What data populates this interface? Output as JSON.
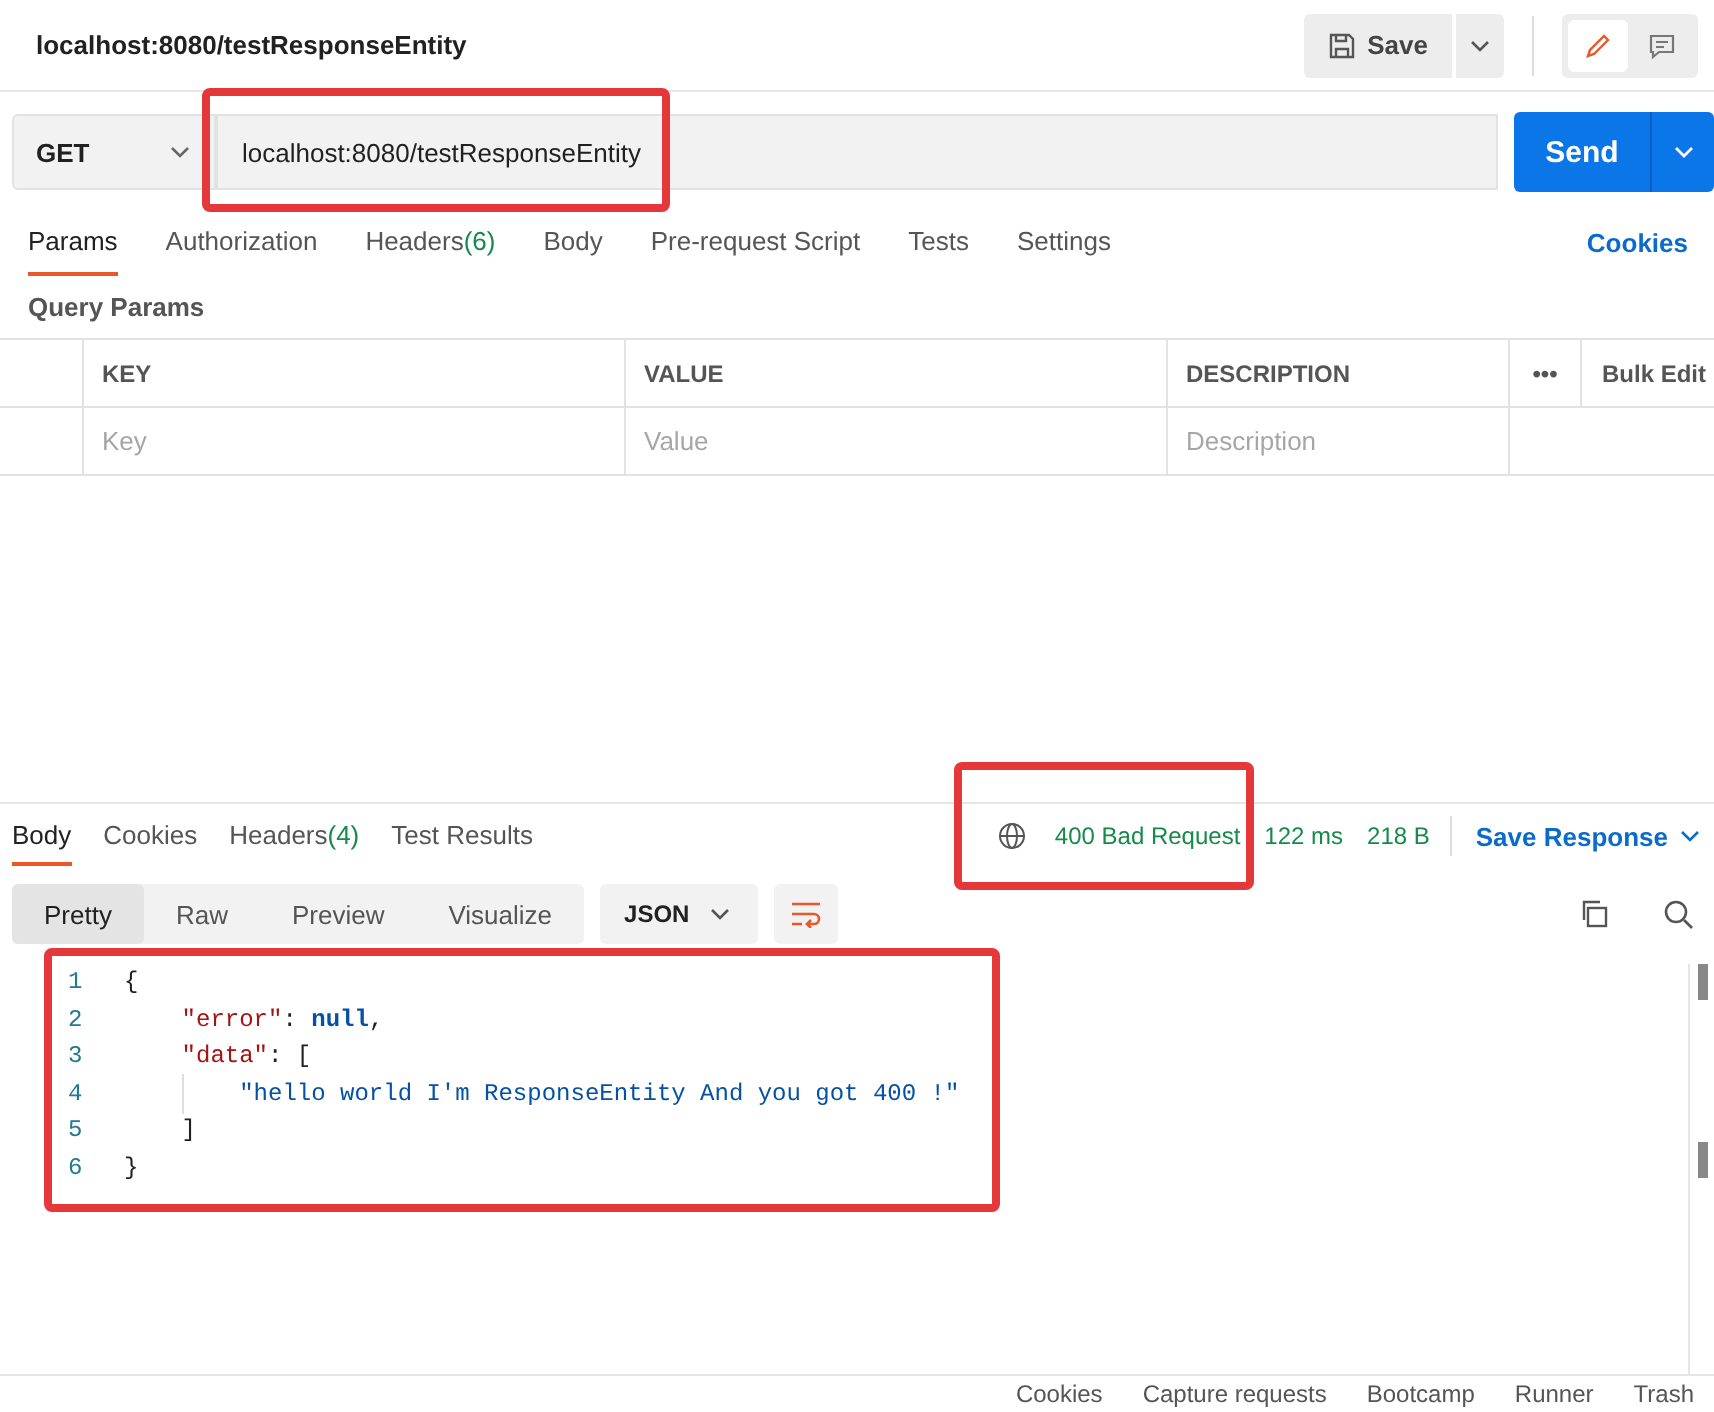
{
  "header": {
    "title": "localhost:8080/testResponseEntity",
    "save": "Save"
  },
  "request": {
    "method": "GET",
    "url": "localhost:8080/testResponseEntity",
    "url_highlighted": true,
    "send": "Send"
  },
  "side_toggle": [
    {
      "kind": "edit",
      "selected": true
    },
    {
      "kind": "comments",
      "selected": false
    }
  ],
  "request_tabs": [
    {
      "label": "Params",
      "selected": true
    },
    {
      "label": "Authorization",
      "selected": false
    },
    {
      "label": "Headers",
      "count": "(6)",
      "selected": false
    },
    {
      "label": "Body",
      "selected": false
    },
    {
      "label": "Pre-request Script",
      "selected": false
    },
    {
      "label": "Tests",
      "selected": false
    },
    {
      "label": "Settings",
      "selected": false
    }
  ],
  "cookies_link": "Cookies",
  "query_params": {
    "title": "Query Params",
    "columns": [
      "KEY",
      "VALUE",
      "DESCRIPTION"
    ],
    "more": "•••",
    "bulk_edit": "Bulk Edit",
    "placeholders": [
      "Key",
      "Value",
      "Description"
    ]
  },
  "response_tabs": [
    {
      "label": "Body",
      "selected": true
    },
    {
      "label": "Cookies",
      "selected": false
    },
    {
      "label": "Headers",
      "count": "(4)",
      "selected": false
    },
    {
      "label": "Test Results",
      "selected": false
    }
  ],
  "response_meta": {
    "status": "400 Bad Request",
    "status_highlighted": true,
    "time": "122 ms",
    "size": "218 B",
    "save_response": "Save Response"
  },
  "view_modes": [
    {
      "label": "Pretty",
      "selected": true
    },
    {
      "label": "Raw",
      "selected": false
    },
    {
      "label": "Preview",
      "selected": false
    },
    {
      "label": "Visualize",
      "selected": false
    }
  ],
  "format": "JSON",
  "body_highlighted": true,
  "code_lines": [
    {
      "number": "1",
      "indent_guide": false,
      "tokens": [
        {
          "kind": "punct",
          "text": "{"
        }
      ]
    },
    {
      "number": "2",
      "indent_guide": false,
      "tokens": [
        {
          "kind": "key",
          "text": "    \"error\""
        },
        {
          "kind": "punct",
          "text": ": "
        },
        {
          "kind": "keyword",
          "text": "null"
        },
        {
          "kind": "punct",
          "text": ","
        }
      ]
    },
    {
      "number": "3",
      "indent_guide": false,
      "tokens": [
        {
          "kind": "key",
          "text": "    \"data\""
        },
        {
          "kind": "punct",
          "text": ": ["
        }
      ]
    },
    {
      "number": "4",
      "indent_guide": true,
      "tokens": [
        {
          "kind": "string",
          "text": "        \"hello world I'm ResponseEntity And you got 400 !\""
        }
      ]
    },
    {
      "number": "5",
      "indent_guide": false,
      "tokens": [
        {
          "kind": "punct",
          "text": "    ]"
        }
      ]
    },
    {
      "number": "6",
      "indent_guide": false,
      "tokens": [
        {
          "kind": "punct",
          "text": "}"
        }
      ]
    }
  ],
  "status_bar": [
    "Cookies",
    "Capture requests",
    "Bootcamp",
    "Runner",
    "Trash"
  ]
}
